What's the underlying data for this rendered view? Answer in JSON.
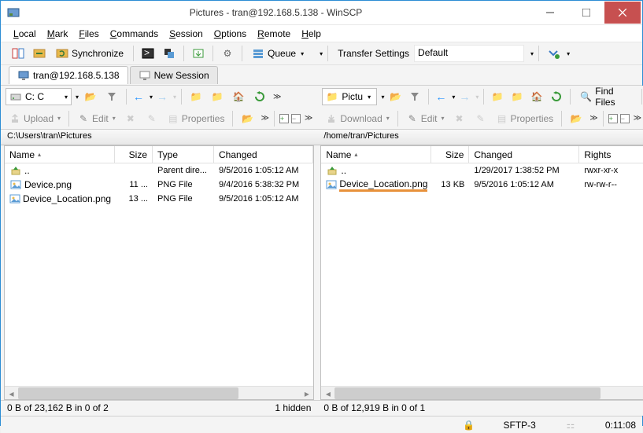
{
  "window": {
    "title": "Pictures - tran@192.168.5.138 - WinSCP"
  },
  "menu": {
    "items": [
      "Local",
      "Mark",
      "Files",
      "Commands",
      "Session",
      "Options",
      "Remote",
      "Help"
    ]
  },
  "toolbar": {
    "synchronize": "Synchronize",
    "queue": "Queue",
    "transfer_label": "Transfer Settings",
    "transfer_value": "Default"
  },
  "tabs": {
    "session": "tran@192.168.5.138",
    "new": "New Session"
  },
  "local": {
    "drive_label": "C: C",
    "find_files": "Find Files",
    "upload": "Upload",
    "edit": "Edit",
    "properties": "Properties",
    "path": "C:\\Users\\tran\\Pictures",
    "columns": [
      "Name",
      "Size",
      "Type",
      "Changed"
    ],
    "rows": [
      {
        "name": "..",
        "size": "",
        "type": "Parent dire...",
        "changed": "9/5/2016  1:05:12 AM",
        "icon": "up"
      },
      {
        "name": "Device.png",
        "size": "11 ...",
        "type": "PNG File",
        "changed": "9/4/2016  5:38:32 PM",
        "icon": "img"
      },
      {
        "name": "Device_Location.png",
        "size": "13 ...",
        "type": "PNG File",
        "changed": "9/5/2016  1:05:12 AM",
        "icon": "img"
      }
    ],
    "status_left": "0 B of 23,162 B in 0 of 2",
    "status_right": "1 hidden"
  },
  "remote": {
    "drive_label": "Pictu",
    "find_files": "Find Files",
    "download": "Download",
    "edit": "Edit",
    "properties": "Properties",
    "path": "/home/tran/Pictures",
    "columns": [
      "Name",
      "Size",
      "Changed",
      "Rights"
    ],
    "rows": [
      {
        "name": "..",
        "size": "",
        "changed": "1/29/2017 1:38:52 PM",
        "rights": "rwxr-xr-x",
        "icon": "up"
      },
      {
        "name": "Device_Location.png",
        "size": "13 KB",
        "changed": "9/5/2016 1:05:12 AM",
        "rights": "rw-rw-r--",
        "icon": "img",
        "highlight": true
      }
    ],
    "status_left": "0 B of 12,919 B in 0 of 1",
    "status_right": ""
  },
  "statusbar": {
    "protocol": "SFTP-3",
    "time": "0:11:08"
  }
}
